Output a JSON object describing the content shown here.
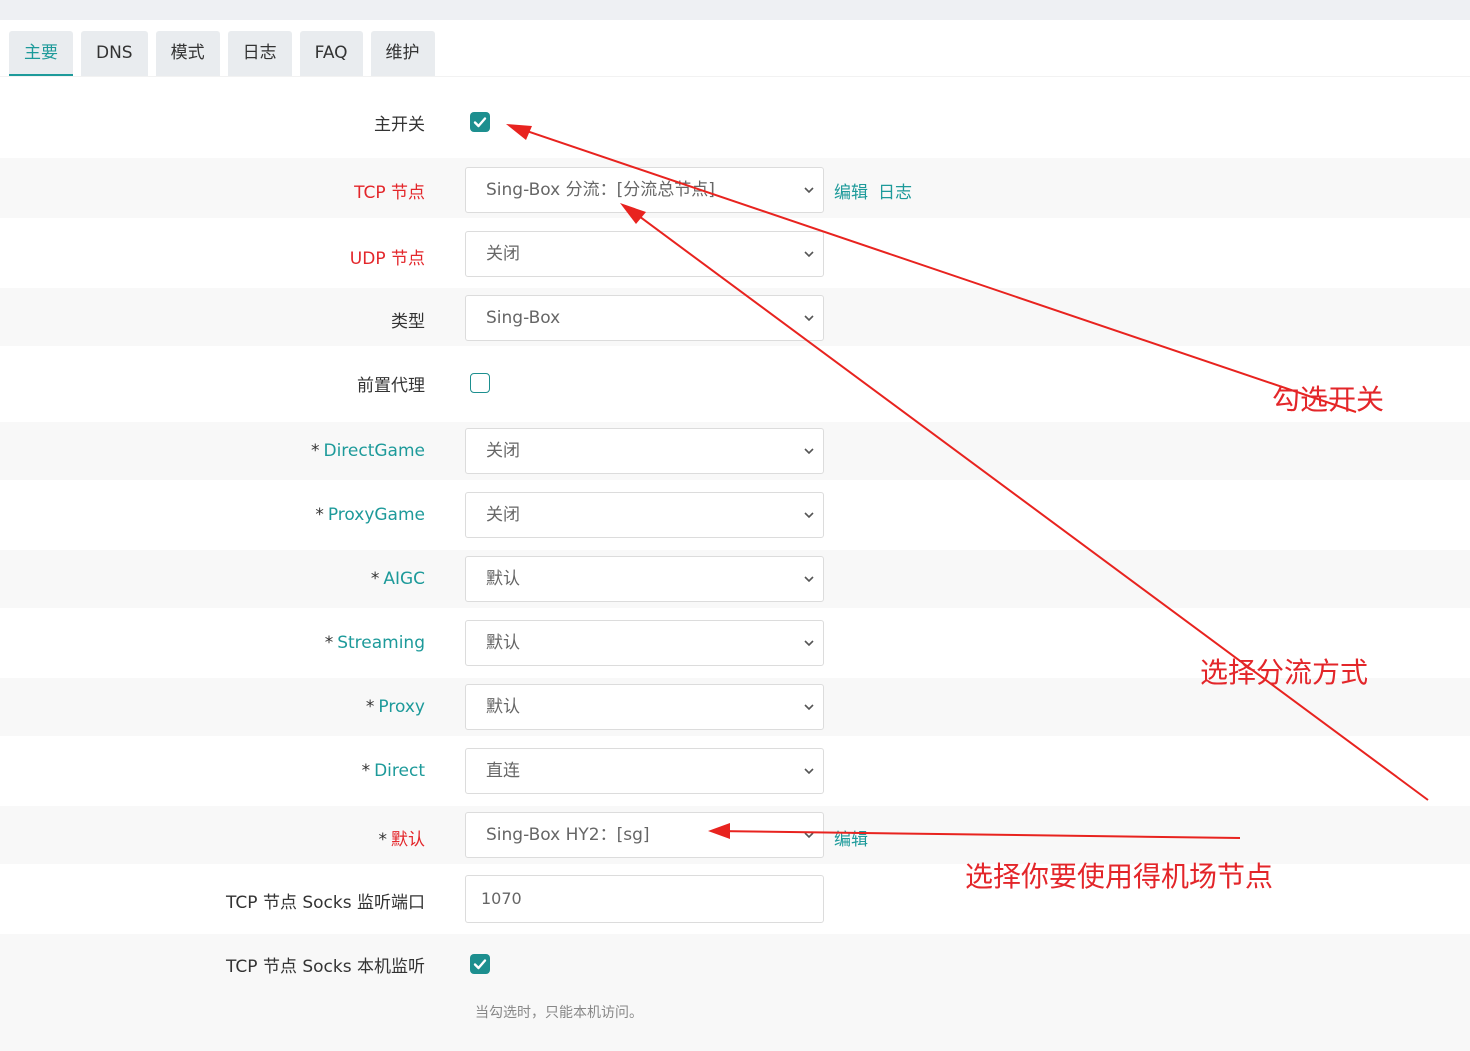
{
  "tabs": [
    "主要",
    "DNS",
    "模式",
    "日志",
    "FAQ",
    "维护"
  ],
  "form": {
    "main_switch": {
      "label": "主开关",
      "checked": true
    },
    "tcp_node": {
      "label": "TCP 节点",
      "value": "Sing-Box 分流：[分流总节点]",
      "edit_link": "编辑",
      "log_link": "日志"
    },
    "udp_node": {
      "label": "UDP 节点",
      "value": "关闭"
    },
    "type": {
      "label": "类型",
      "value": "Sing-Box"
    },
    "pre_proxy": {
      "label": "前置代理",
      "checked": false
    },
    "direct_game": {
      "star": "*",
      "label": "DirectGame",
      "value": "关闭"
    },
    "proxy_game": {
      "star": "*",
      "label": "ProxyGame",
      "value": "关闭"
    },
    "aigc": {
      "star": "*",
      "label": "AIGC",
      "value": "默认"
    },
    "streaming": {
      "star": "*",
      "label": "Streaming",
      "value": "默认"
    },
    "proxy": {
      "star": "*",
      "label": "Proxy",
      "value": "默认"
    },
    "direct": {
      "star": "*",
      "label": "Direct",
      "value": "直连"
    },
    "default": {
      "star": "*",
      "label": "默认",
      "value": "Sing-Box HY2：[sg]",
      "edit_link": "编辑"
    },
    "socks_port": {
      "label": "TCP 节点 Socks 监听端口",
      "value": "1070"
    },
    "socks_local": {
      "label": "TCP 节点 Socks 本机监听",
      "checked": true,
      "hint": "当勾选时，只能本机访问。"
    }
  },
  "annotations": {
    "check_switch": "勾选开关",
    "choose_mode": "选择分流方式",
    "choose_node": "选择你要使用得机场节点"
  },
  "colors": {
    "accent": "#1d9a9a",
    "required": "#e3262a",
    "annotation": "#e3262a"
  }
}
